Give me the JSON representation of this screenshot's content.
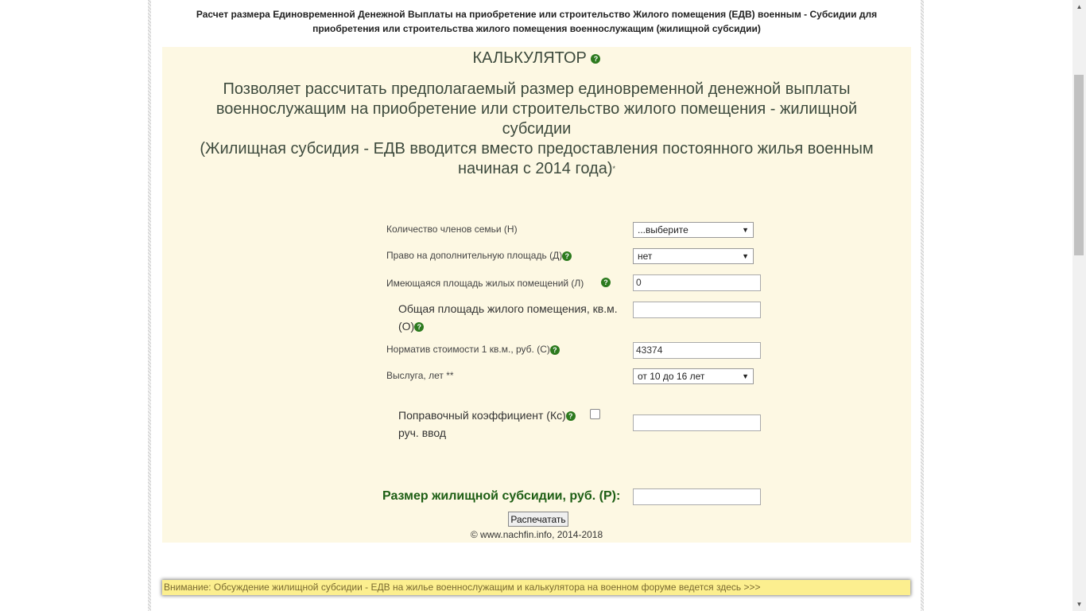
{
  "page": {
    "heading_line1": "Расчет размера Единовременной Денежной Выплаты на приобретение или строительство Жилого помещения (ЕДВ) военным - Субсидии для",
    "heading_line2": "приобретения или строительства жилого помещения военнослужащим (жилищной субсидии)"
  },
  "calculator": {
    "title": "КАЛЬКУЛЯТОР",
    "help_icon": "?",
    "desc_line1": "Позволяет рассчитать предполагаемый размер единовременной денежной выплаты",
    "desc_line2": "военнослужащим на приобретение или строительство жилого помещения - жилищной",
    "desc_line3": "субсидии",
    "desc_line4": "(Жилищная субсидия - ЕДВ вводится вместо предоставления постоянного жилья военным",
    "desc_line5": "начиная с 2014 года)",
    "asterisk": "*"
  },
  "form": {
    "family_label": "Количество членов семьи (Н)",
    "family_value": "...выберите",
    "extra_area_label": "Право на дополнительную площадь (Д)",
    "extra_area_value": "нет",
    "existing_area_label": "Имеющаяся площадь жилых помещений (Л)",
    "existing_area_value": "0",
    "total_area_label_line1": "Общая площадь жилого помещения, кв.м.",
    "total_area_label_line2": "(О)",
    "total_area_value": "",
    "norm_cost_label": "Норматив стоимости 1 кв.м., руб. (С)",
    "norm_cost_value": "43374",
    "service_label": "Выслуга, лет **",
    "service_value": "от 10 до 16 лет",
    "coef_label_line1": "Поправочный коэффициент (Кс)",
    "coef_label_line2": "руч. ввод",
    "coef_value": "",
    "result_label": "Размер жилищной субсидии, руб. (Р):",
    "result_value": "",
    "print_button": "Распечатать",
    "copyright": "© www.nachfin.info, 2014-2018"
  },
  "notice": {
    "text": "Внимание: Обсуждение жилищной субсидии - ЕДВ на жилье военнослужащим и калькулятора на военном форуме ведется здесь >>>"
  },
  "colors": {
    "panel_bg": "#fdf8e3",
    "accent_green": "#2c7a1e",
    "notice_bg": "#fcef8f"
  }
}
